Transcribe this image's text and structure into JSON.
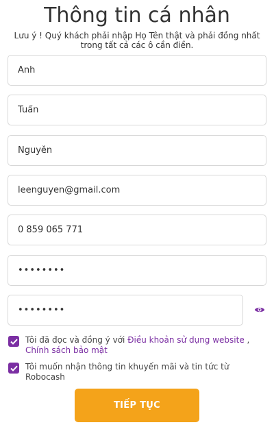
{
  "header": {
    "title": "Thông tin cá nhân",
    "notice_line1": "Lưu ý ! Quý khách phải nhập Họ Tên thật và phải đồng nhất",
    "notice_line2": "trong tất cả các ô cần điền."
  },
  "form": {
    "first_name": "Anh",
    "middle_name": "Tuấn",
    "last_name": "Nguyễn",
    "email": "leenguyen@gmail.com",
    "phone": "0 859 065 771",
    "password": "••••••••",
    "confirm_password": "••••••••"
  },
  "consent": {
    "terms_prefix": "Tôi đã đọc và đồng ý với ",
    "terms_link": "Điều khoản sử dụng website",
    "terms_separator": " , ",
    "privacy_link": "Chính sách bảo mật",
    "terms_checked": true,
    "promo_text": "Tôi muốn nhận thông tin khuyến mãi và tin tức từ Robocash",
    "promo_checked": true
  },
  "actions": {
    "submit_label": "TIẾP TỤC"
  },
  "icons": {
    "eye": "eye-icon",
    "checkmark": "checkmark-icon"
  },
  "colors": {
    "accent_purple": "#7b2fa3",
    "button_orange": "#f4a31a",
    "border_gray": "#d7d7d7"
  }
}
